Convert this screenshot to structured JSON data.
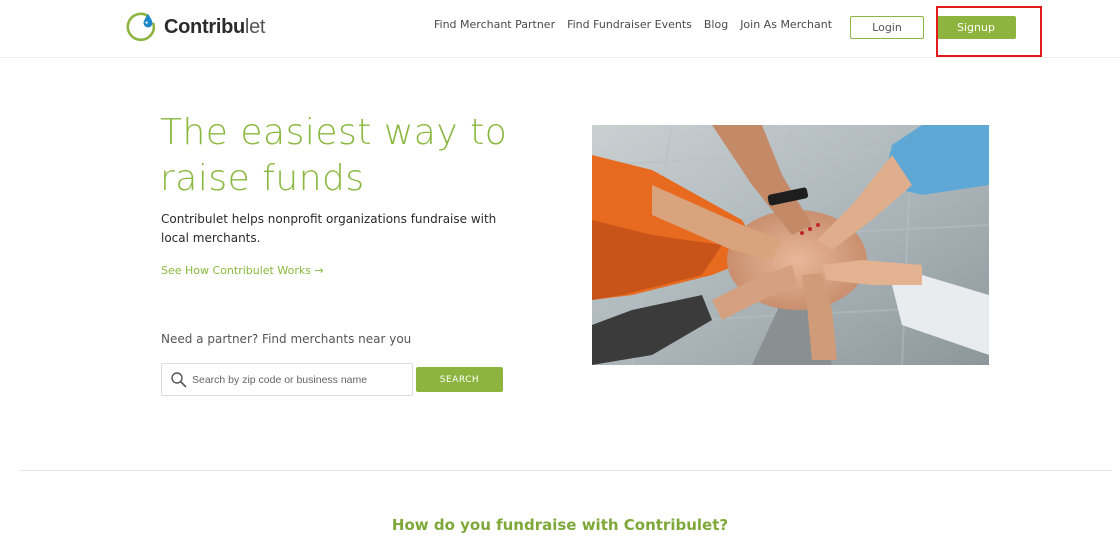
{
  "brand": {
    "name_bold": "Contribu",
    "name_light": "let",
    "accent_color": "#8cb43e",
    "logo_icon": "water-drop-icon"
  },
  "nav": {
    "items": [
      {
        "label": "Find Merchant Partner"
      },
      {
        "label": "Find Fundraiser Events"
      },
      {
        "label": "Blog"
      },
      {
        "label": "Join As Merchant"
      }
    ],
    "login_label": "Login",
    "signup_label": "Signup"
  },
  "hero": {
    "title_line1": "The easiest way to",
    "title_line2": "raise funds",
    "description": "Contribulet helps nonprofit organizations fundraise with local merchants.",
    "link_label": "See How Contribulet Works →",
    "partner_label": "Need a partner? Find merchants near you",
    "search_placeholder": "Search by zip code or business name",
    "search_button_label": "SEARCH",
    "image_alt": "Team hands stacked together"
  },
  "section": {
    "title": "How do you fundraise with Contribulet?"
  },
  "annotation": {
    "highlight_color": "#e21a1a"
  }
}
